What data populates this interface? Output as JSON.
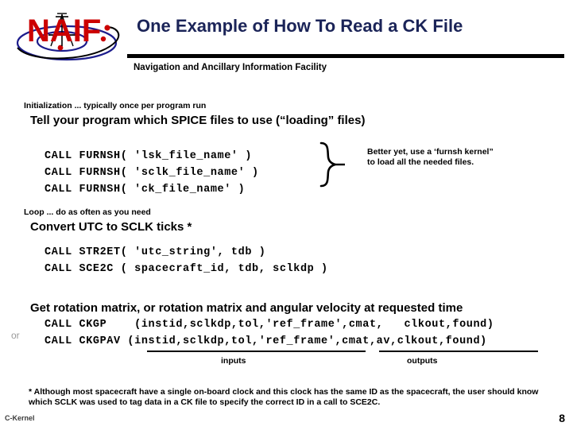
{
  "header": {
    "logo_text": "NAIF",
    "title": "One Example of How To Read a CK File",
    "facility": "Navigation and Ancillary Information Facility"
  },
  "sections": [
    {
      "kicker": "Initialization ... typically once per program run",
      "heading": "Tell your program which SPICE files to use (“loading” files)",
      "code": [
        "CALL FURNSH( 'lsk_file_name' )",
        "CALL FURNSH( 'sclk_file_name' )",
        "CALL FURNSH( 'ck_file_name' )"
      ],
      "note": "Better yet, use a ‘furnsh kernel”\nto load all the needed files."
    },
    {
      "kicker": "Loop ... do as often as you need",
      "heading": "Convert UTC to SCLK ticks *",
      "code": [
        "CALL STR2ET( 'utc_string', tdb )",
        "CALL SCE2C ( spacecraft_id, tdb, sclkdp )"
      ]
    },
    {
      "heading": "Get rotation matrix, or rotation matrix and angular velocity at requested time",
      "or_label": "or",
      "code": [
        "CALL CKGP    (instid,sclkdp,tol,'ref_frame',cmat,   clkout,found)",
        "CALL CKGPAV (instid,sclkdp,tol,'ref_frame',cmat,av,clkout,found)"
      ],
      "inputs_label": "inputs",
      "outputs_label": "outputs"
    }
  ],
  "footnote": "* Although most spacecraft have a single on-board clock and this clock has the same ID as the spacecraft, the user should know which SCLK was used to tag data in a CK file to specify the correct ID in a call to SCE2C.",
  "footer": {
    "left": "C-Kernel",
    "page": "8"
  },
  "colors": {
    "title": "#1b2458",
    "logo_red": "#cc0000",
    "logo_blue": "#1c1c8c",
    "rule": "#000000",
    "or": "#9a9a9a"
  }
}
